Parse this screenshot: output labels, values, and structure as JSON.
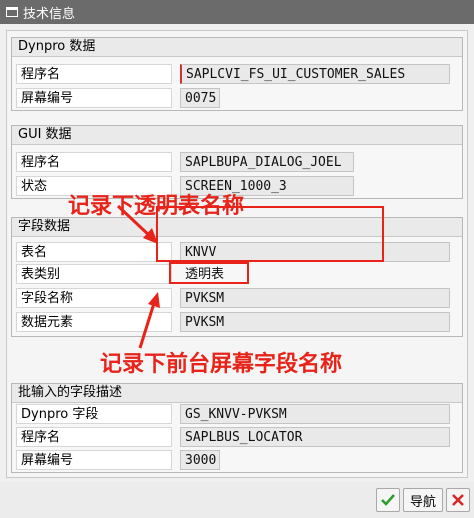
{
  "window": {
    "title": "技术信息"
  },
  "groups": {
    "dynpro": {
      "title": "Dynpro 数据",
      "rows": [
        {
          "label": "程序名",
          "value": "SAPLCVI_FS_UI_CUSTOMER_SALES"
        },
        {
          "label": "屏幕编号",
          "value": "0075"
        }
      ]
    },
    "gui": {
      "title": "GUI 数据",
      "rows": [
        {
          "label": "程序名",
          "value": "SAPLBUPA_DIALOG_JOEL"
        },
        {
          "label": "状态",
          "value": "SCREEN_1000_3"
        }
      ]
    },
    "field": {
      "title": "字段数据",
      "rows": [
        {
          "label": "表名",
          "value": "KNVV"
        },
        {
          "label": "表类别",
          "value": "透明表"
        },
        {
          "label": "字段名称",
          "value": "PVKSM"
        },
        {
          "label": "数据元素",
          "value": "PVKSM"
        }
      ]
    },
    "batch": {
      "title": "批输入的字段描述",
      "rows": [
        {
          "label": "Dynpro 字段",
          "value": "GS_KNVV-PVKSM"
        },
        {
          "label": "程序名",
          "value": "SAPLBUS_LOCATOR"
        },
        {
          "label": "屏幕编号",
          "value": "3000"
        }
      ]
    }
  },
  "annotations": {
    "table_note": "记录下透明表名称",
    "field_note": "记录下前台屏幕字段名称"
  },
  "buttons": {
    "confirm_icon": "check-icon",
    "navigate_label": "导航",
    "cancel_icon": "x-icon"
  },
  "colors": {
    "annotation": "#e8231a",
    "confirm": "#2e9d2e",
    "cancel": "#d42a2a"
  }
}
